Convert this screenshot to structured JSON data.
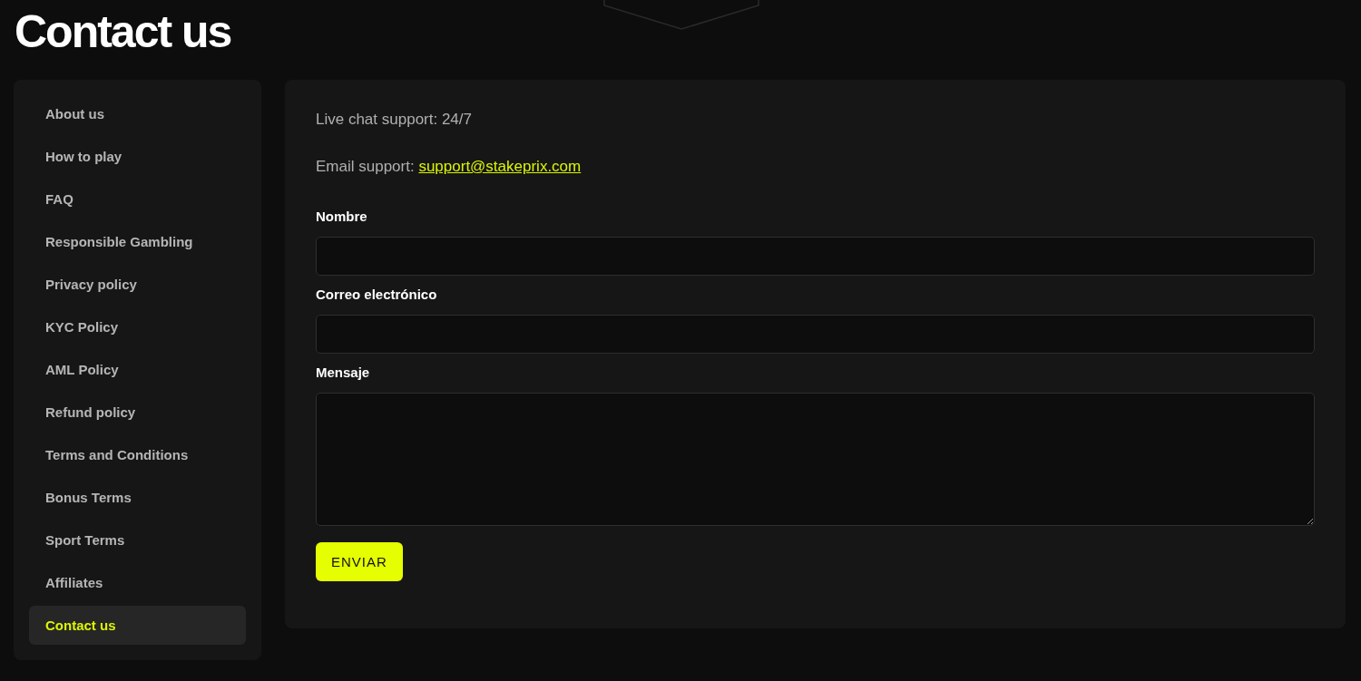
{
  "page_title": "Contact us",
  "sidebar": {
    "items": [
      {
        "label": "About us",
        "selected": false
      },
      {
        "label": "How to play",
        "selected": false
      },
      {
        "label": "FAQ",
        "selected": false
      },
      {
        "label": "Responsible Gambling",
        "selected": false
      },
      {
        "label": "Privacy policy",
        "selected": false
      },
      {
        "label": "KYC Policy",
        "selected": false
      },
      {
        "label": "AML Policy",
        "selected": false
      },
      {
        "label": "Refund policy",
        "selected": false
      },
      {
        "label": "Terms and Conditions",
        "selected": false
      },
      {
        "label": "Bonus Terms",
        "selected": false
      },
      {
        "label": "Sport Terms",
        "selected": false
      },
      {
        "label": "Affiliates",
        "selected": false
      },
      {
        "label": "Contact us",
        "selected": true
      }
    ]
  },
  "contact": {
    "live_chat_text": "Live chat support: 24/7",
    "email_label": "Email support:",
    "email_link": "support@stakeprix.com",
    "fields": [
      {
        "label": "Nombre",
        "kind": "input"
      },
      {
        "label": "Correo electrónico",
        "kind": "input"
      },
      {
        "label": "Mensaje",
        "kind": "textarea"
      }
    ],
    "submit_button": "ENVIAR"
  }
}
